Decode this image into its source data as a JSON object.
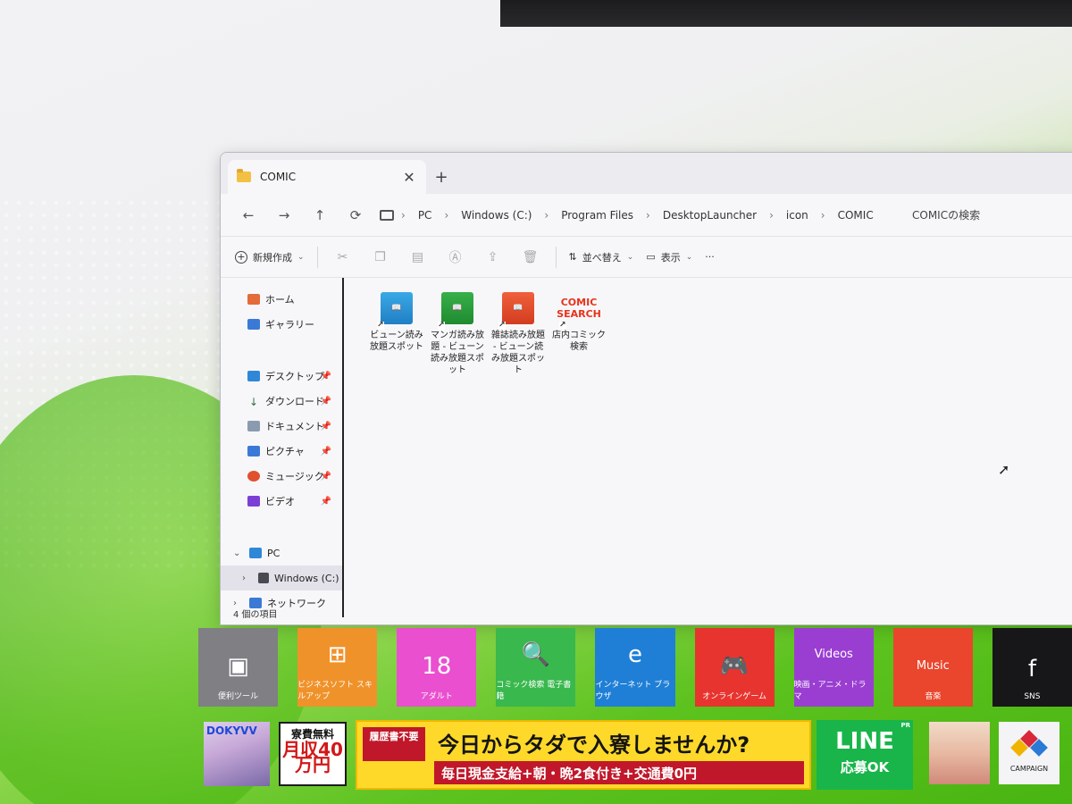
{
  "window": {
    "tab_title": "COMIC",
    "new_tab": "+",
    "close": "✕"
  },
  "nav": {
    "back": "←",
    "forward": "→",
    "up": "↑",
    "refresh": "⟳"
  },
  "breadcrumb": [
    "PC",
    "Windows (C:)",
    "Program Files",
    "DesktopLauncher",
    "icon",
    "COMIC"
  ],
  "search": {
    "placeholder": "COMICの検索"
  },
  "toolbar": {
    "new_label": "新規作成",
    "sort_label": "並べ替え",
    "view_label": "表示",
    "more": "···"
  },
  "sidebar": {
    "quick": [
      {
        "label": "ホーム",
        "icon": "home-icon"
      },
      {
        "label": "ギャラリー",
        "icon": "gallery-icon"
      }
    ],
    "pinned": [
      {
        "label": "デスクトップ",
        "icon": "desktop-icon"
      },
      {
        "label": "ダウンロード",
        "icon": "download-icon"
      },
      {
        "label": "ドキュメント",
        "icon": "document-icon"
      },
      {
        "label": "ピクチャ",
        "icon": "pictures-icon"
      },
      {
        "label": "ミュージック",
        "icon": "music-icon"
      },
      {
        "label": "ビデオ",
        "icon": "video-icon"
      }
    ],
    "tree": [
      {
        "label": "PC",
        "chevron": "⌄"
      },
      {
        "label": "Windows (C:)",
        "chevron": "›"
      },
      {
        "label": "ネットワーク",
        "chevron": "›"
      }
    ]
  },
  "files": [
    {
      "name": "ビューン読み放題スポット",
      "color": "blue"
    },
    {
      "name": "マンガ読み放題 - ビューン読み放題スポット",
      "color": "green"
    },
    {
      "name": "雑誌読み放題 - ビューン読み放題スポット",
      "color": "red"
    },
    {
      "name": "店内コミック検索",
      "color": "search",
      "thumb_text": "COMIC SEARCH"
    }
  ],
  "status": {
    "count": "4 個の項目"
  },
  "launcher": [
    {
      "label": "便利ツール",
      "icon": "tv-icon"
    },
    {
      "label": "ビジネスソフト スキルアップ",
      "icon": "business-icon"
    },
    {
      "label": "アダルト",
      "icon": "heart-18-icon",
      "glyph": "18"
    },
    {
      "label": "コミック検索 電子書籍",
      "icon": "comic-search-icon"
    },
    {
      "label": "インターネット ブラウザ",
      "icon": "browser-icon",
      "glyph": "e"
    },
    {
      "label": "オンラインゲーム",
      "icon": "gamepad-icon"
    },
    {
      "label": "映画・アニメ・ドラマ",
      "icon": "videos-icon",
      "glyph": "Videos"
    },
    {
      "label": "音楽",
      "icon": "music-note-icon",
      "glyph": "Music"
    },
    {
      "label": "SNS",
      "icon": "sns-icon",
      "glyph": "f"
    }
  ],
  "banners": {
    "dvd": "DOKYVV",
    "ryohi_l1": "寮費無料",
    "ryohi_l2": "月収40万円",
    "main_badge": "履歴書不要",
    "main_headline": "今日からタダで入寮しませんか?",
    "main_sub": "毎日現金支給+朝・晩2食付き+交通費0円",
    "line_l1": "LINE",
    "line_l2": "応募OK",
    "line_pr": "PR",
    "campaign": "CAMPAIGN"
  }
}
